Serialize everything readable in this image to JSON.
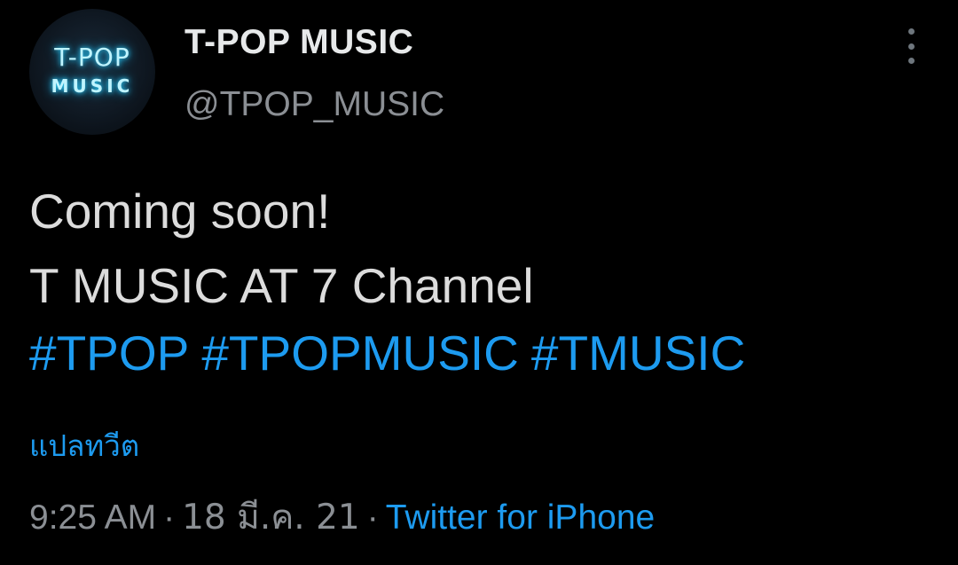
{
  "profile": {
    "avatar_line1": "T-POP",
    "avatar_line2": "MUSIC",
    "display_name": "T-POP MUSIC",
    "handle": "@TPOP_MUSIC"
  },
  "tweet": {
    "line1": "Coming soon!",
    "line2": "T MUSIC AT 7 Channel",
    "hashtags": [
      "#TPOP",
      "#TPOPMUSIC",
      "#TMUSIC"
    ],
    "translate_label": "แปลทวีต",
    "time": "9:25 AM",
    "separator": "·",
    "date": "18 มี.ค. 21",
    "source": "Twitter for iPhone"
  },
  "colors": {
    "background": "#000000",
    "link": "#1d9bf0",
    "secondary_text": "#8b8f94",
    "primary_text": "#e7e9ea",
    "neon": "#2fd6ff"
  },
  "icons": {
    "more": "more-vertical-icon"
  }
}
